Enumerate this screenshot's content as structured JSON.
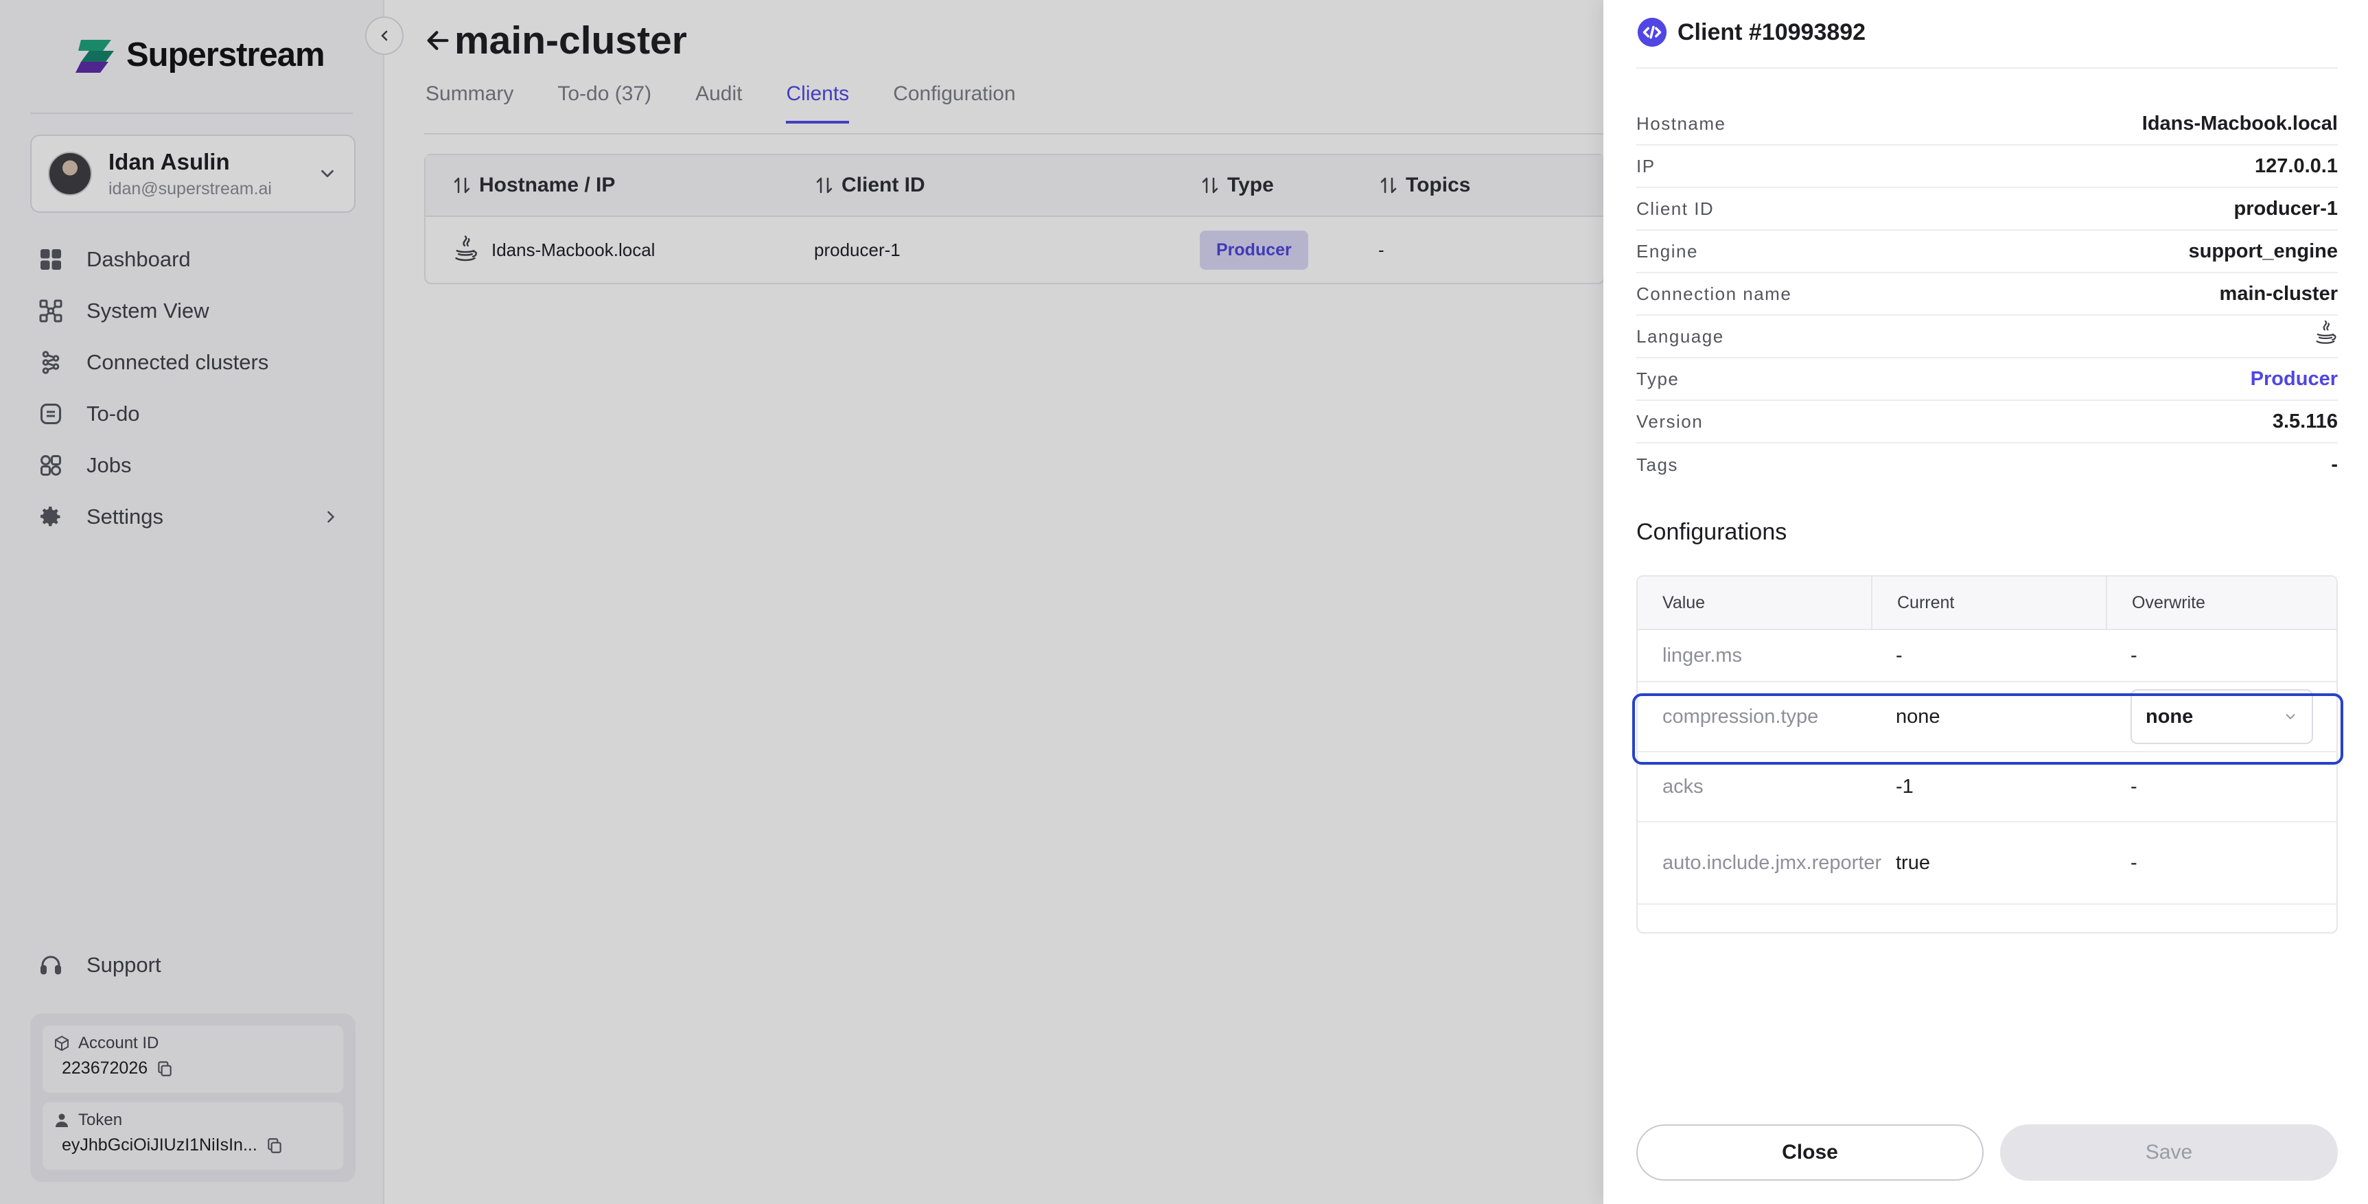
{
  "brand": {
    "name": "Superstream",
    "mark_colors": [
      "#18a47a",
      "#5b2aa8"
    ]
  },
  "user": {
    "name": "Idan Asulin",
    "email": "idan@superstream.ai"
  },
  "nav": {
    "items": [
      {
        "label": "Dashboard",
        "icon": "grid-icon"
      },
      {
        "label": "System View",
        "icon": "system-view-icon"
      },
      {
        "label": "Connected clusters",
        "icon": "clusters-icon"
      },
      {
        "label": "To-do",
        "icon": "todo-icon"
      },
      {
        "label": "Jobs",
        "icon": "jobs-icon"
      },
      {
        "label": "Settings",
        "icon": "gear-icon"
      }
    ],
    "support": "Support"
  },
  "account": {
    "id_label": "Account ID",
    "id_value": "223672026",
    "token_label": "Token",
    "token_value": "eyJhbGciOiJIUzI1NiIsIn..."
  },
  "page": {
    "title": "main-cluster",
    "tabs": [
      "Summary",
      "To-do (37)",
      "Audit",
      "Clients",
      "Configuration"
    ],
    "active_tab": "Clients"
  },
  "clients_table": {
    "headers": [
      "Hostname / IP",
      "Client ID",
      "Type",
      "Topics"
    ],
    "rows": [
      {
        "hostname": "Idans-Macbook.local",
        "client_id": "producer-1",
        "type": "Producer",
        "topics": "-"
      }
    ]
  },
  "drawer": {
    "title": "Client #10993892",
    "details": [
      {
        "label": "Hostname",
        "value": "Idans-Macbook.local"
      },
      {
        "label": "IP",
        "value": "127.0.0.1"
      },
      {
        "label": "Client ID",
        "value": "producer-1"
      },
      {
        "label": "Engine",
        "value": "support_engine"
      },
      {
        "label": "Connection name",
        "value": "main-cluster"
      },
      {
        "label": "Language",
        "value": "",
        "icon": "java-icon"
      },
      {
        "label": "Type",
        "value": "Producer"
      },
      {
        "label": "Version",
        "value": "3.5.116"
      },
      {
        "label": "Tags",
        "value": "-"
      }
    ],
    "config_title": "Configurations",
    "config_headers": [
      "Value",
      "Current",
      "Overwrite"
    ],
    "config_rows": [
      {
        "key": "linger.ms",
        "current": "-",
        "overwrite": "-"
      },
      {
        "key": "compression.type",
        "current": "none",
        "overwrite": "none"
      },
      {
        "key": "acks",
        "current": "-1",
        "overwrite": "-"
      },
      {
        "key": "auto.include.jmx.reporter",
        "current": "true",
        "overwrite": "-"
      }
    ],
    "close_label": "Close",
    "save_label": "Save"
  },
  "colors": {
    "accent": "#5046e4",
    "highlight_border": "#2742c8",
    "badge_bg": "#d9d7f5"
  }
}
